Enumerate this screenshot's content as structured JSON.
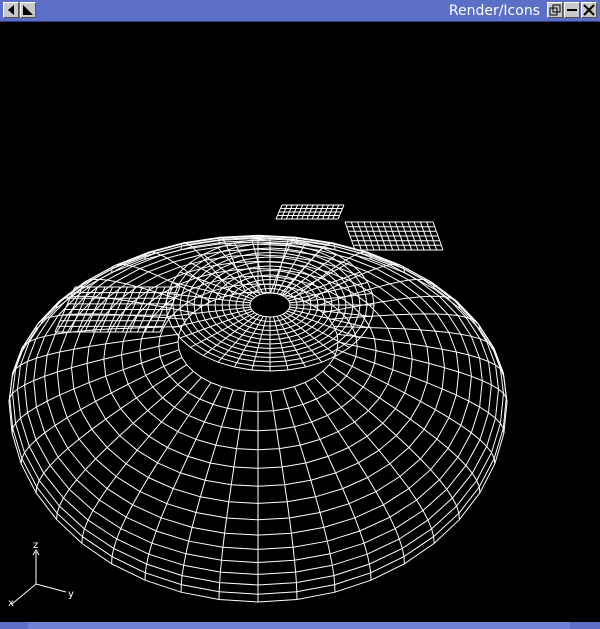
{
  "window": {
    "title": "Render/Icons",
    "titlebar_color": "#5b6fc9",
    "background": "#000000",
    "wireframe_color": "#ffffff"
  },
  "titlebar": {
    "left_buttons": [
      "window-menu-icon",
      "shade-icon"
    ],
    "right_buttons": [
      "restore-icon",
      "minimize-icon",
      "close-icon"
    ]
  },
  "axes": {
    "x": "x",
    "y": "y",
    "z": "z"
  }
}
